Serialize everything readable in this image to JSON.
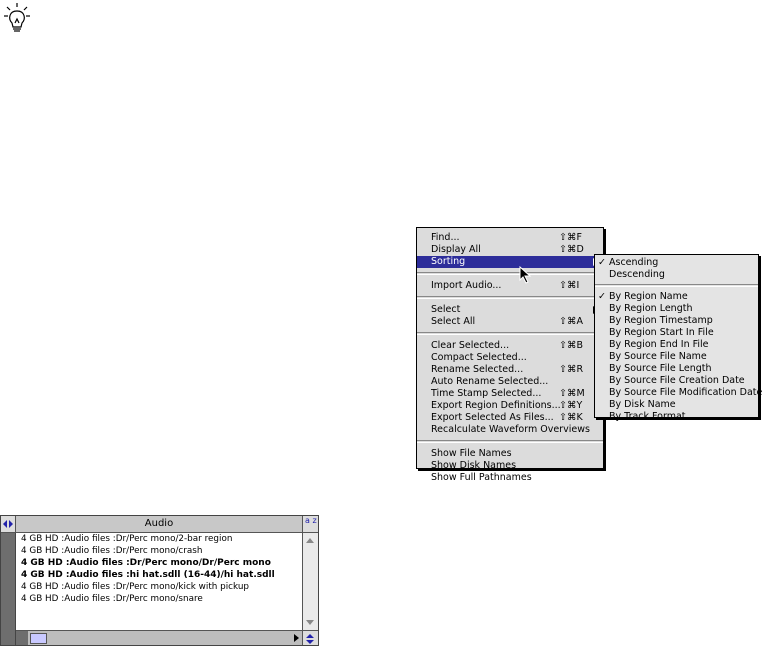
{
  "menu": {
    "items": [
      {
        "label": "Find...",
        "shortcut": "⇧⌘F"
      },
      {
        "label": "Display All",
        "shortcut": "⇧⌘D"
      },
      {
        "label": "Sorting",
        "shortcut": ""
      },
      {
        "label": "Import Audio...",
        "shortcut": "⇧⌘I"
      },
      {
        "label": "Select",
        "shortcut": ""
      },
      {
        "label": "Select All",
        "shortcut": "⇧⌘A"
      },
      {
        "label": "Clear Selected...",
        "shortcut": "⇧⌘B"
      },
      {
        "label": "Compact Selected...",
        "shortcut": ""
      },
      {
        "label": "Rename Selected...",
        "shortcut": "⇧⌘R"
      },
      {
        "label": "Auto Rename Selected...",
        "shortcut": ""
      },
      {
        "label": "Time Stamp Selected...",
        "shortcut": "⇧⌘M"
      },
      {
        "label": "Export Region Definitions...",
        "shortcut": "⇧⌘Y"
      },
      {
        "label": "Export Selected As Files...",
        "shortcut": "⇧⌘K"
      },
      {
        "label": "Recalculate Waveform Overviews",
        "shortcut": ""
      },
      {
        "label": "Show File Names",
        "shortcut": ""
      },
      {
        "label": "Show Disk Names",
        "shortcut": ""
      },
      {
        "label": "Show Full Pathnames",
        "shortcut": ""
      }
    ],
    "highlight_color": "#2d2d9a"
  },
  "submenu": {
    "items": [
      {
        "label": "Ascending",
        "check": "✓"
      },
      {
        "label": "Descending",
        "check": ""
      },
      {
        "label": "By Region Name",
        "check": "✓"
      },
      {
        "label": "By Region Length",
        "check": ""
      },
      {
        "label": "By Region Timestamp",
        "check": ""
      },
      {
        "label": "By Region Start In File",
        "check": ""
      },
      {
        "label": "By Region End In File",
        "check": ""
      },
      {
        "label": "By Source File Name",
        "check": ""
      },
      {
        "label": "By Source File Length",
        "check": ""
      },
      {
        "label": "By Source File Creation Date",
        "check": ""
      },
      {
        "label": "By Source File Modification Date",
        "check": ""
      },
      {
        "label": "By Disk Name",
        "check": ""
      },
      {
        "label": "By Track Format",
        "check": ""
      }
    ]
  },
  "audio_window": {
    "title": "Audio",
    "sort_glyph": "a z",
    "rows": [
      "4 GB HD :Audio files :Dr/Perc mono/2-bar region",
      "4 GB HD :Audio files :Dr/Perc mono/crash",
      "4 GB HD :Audio files :Dr/Perc mono/Dr/Perc mono",
      "4 GB HD :Audio files :hi hat.sdll (16-44)/hi hat.sdll",
      "4 GB HD :Audio files :Dr/Perc mono/kick with pickup",
      "4 GB HD :Audio files :Dr/Perc mono/snare"
    ]
  }
}
